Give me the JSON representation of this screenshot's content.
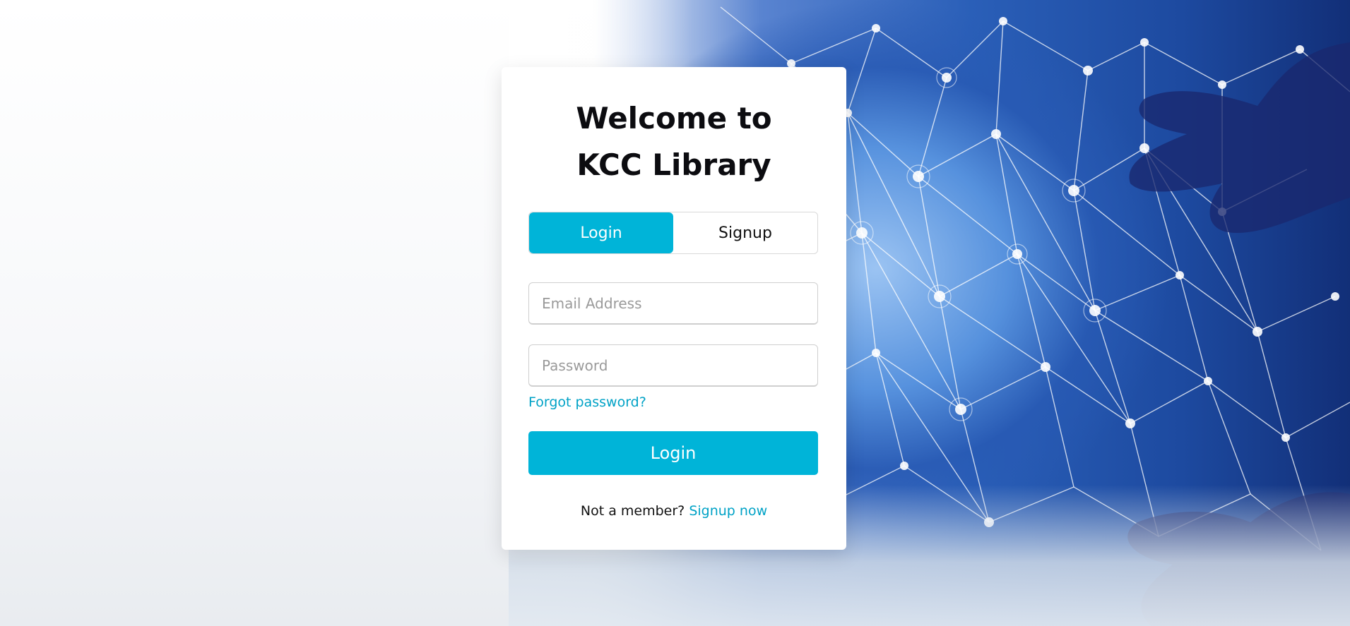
{
  "welcome": {
    "line1": "Welcome to",
    "line2": "KCC Library"
  },
  "tabs": [
    {
      "label": "Login",
      "active": true
    },
    {
      "label": "Signup",
      "active": false
    }
  ],
  "form": {
    "email_placeholder": "Email Address",
    "password_placeholder": "Password",
    "forgot_label": "Forgot password?",
    "submit_label": "Login"
  },
  "footer": {
    "prompt": "Not a member?",
    "link_label": "Signup now"
  },
  "colors": {
    "accent": "#00b4d8",
    "link": "#00a2c6"
  },
  "background": {
    "icon": "globe-network-hands-image"
  }
}
